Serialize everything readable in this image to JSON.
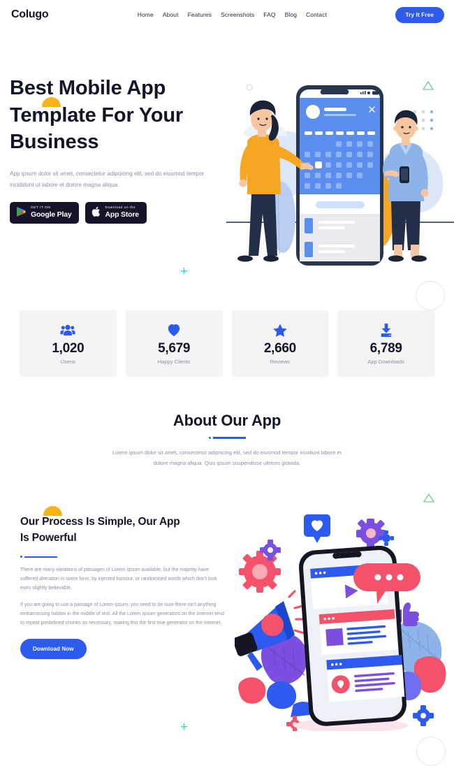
{
  "nav": {
    "brand": "Colugo",
    "links": [
      {
        "label": "Home"
      },
      {
        "label": "About"
      },
      {
        "label": "Features"
      },
      {
        "label": "Screenshots"
      },
      {
        "label": "FAQ"
      },
      {
        "label": "Blog"
      },
      {
        "label": "Contact"
      }
    ],
    "cta_label": "Try It Free"
  },
  "hero": {
    "title_line1": "Best Mobile App",
    "title_line2": "Template For Your",
    "title_line3": "Business",
    "subtitle": "App ipsum dolor sit amet, consectetur adipiscing elit, sed do eiusmod tempor incididunt ut labore et dolore magna aliqua.",
    "google_play": {
      "small": "GET IT ON",
      "big": "Google Play"
    },
    "app_store": {
      "small": "Download on the",
      "big": "App Store"
    }
  },
  "stats": [
    {
      "icon": "users-icon",
      "value": "1,020",
      "label": "Usersr"
    },
    {
      "icon": "heart-icon",
      "value": "5,679",
      "label": "Happy Clients"
    },
    {
      "icon": "star-icon",
      "value": "2,660",
      "label": "Reviews"
    },
    {
      "icon": "download-icon",
      "value": "6,789",
      "label": "App Downloads"
    }
  ],
  "about": {
    "title": "About Our App",
    "subtitle": "Lorem ipsum dolor sit amet, consectetur adipiscing elit, sed do eiusmod tempor incidiunt labore et dolore magna aliqua. Quis ipsum suspendisse ultrices gravida."
  },
  "process": {
    "title_line1": "Our Process Is Simple, Our App",
    "title_line2": "Is Powerful",
    "paragraph1": "There are many variations of passages of Lorem Ipsum available, but the majority have suffered alteration in some form, by injected humour, or randomised words which don't look even slightly believable.",
    "paragraph2": "If you are going to use a passage of Lorem Ipsum, you need to be sure there isn't anything embarrassing hidden in the middle of text. All the Lorem Ipsum generators on the Internet tend to repeat predefined chunks as necessary, making this the first true generator on the Internet.",
    "button_label": "Download Now"
  },
  "colors": {
    "brand_blue": "#2d5bf0",
    "dark": "#14142b",
    "muted": "#8a8fa3",
    "card_bg": "#f4f4f5",
    "accent_yellow": "#f7b418",
    "accent_teal": "#21e6b8",
    "accent_green": "#4ec77c",
    "accent_pink": "#f4526a",
    "accent_purple": "#7b4fe0"
  }
}
